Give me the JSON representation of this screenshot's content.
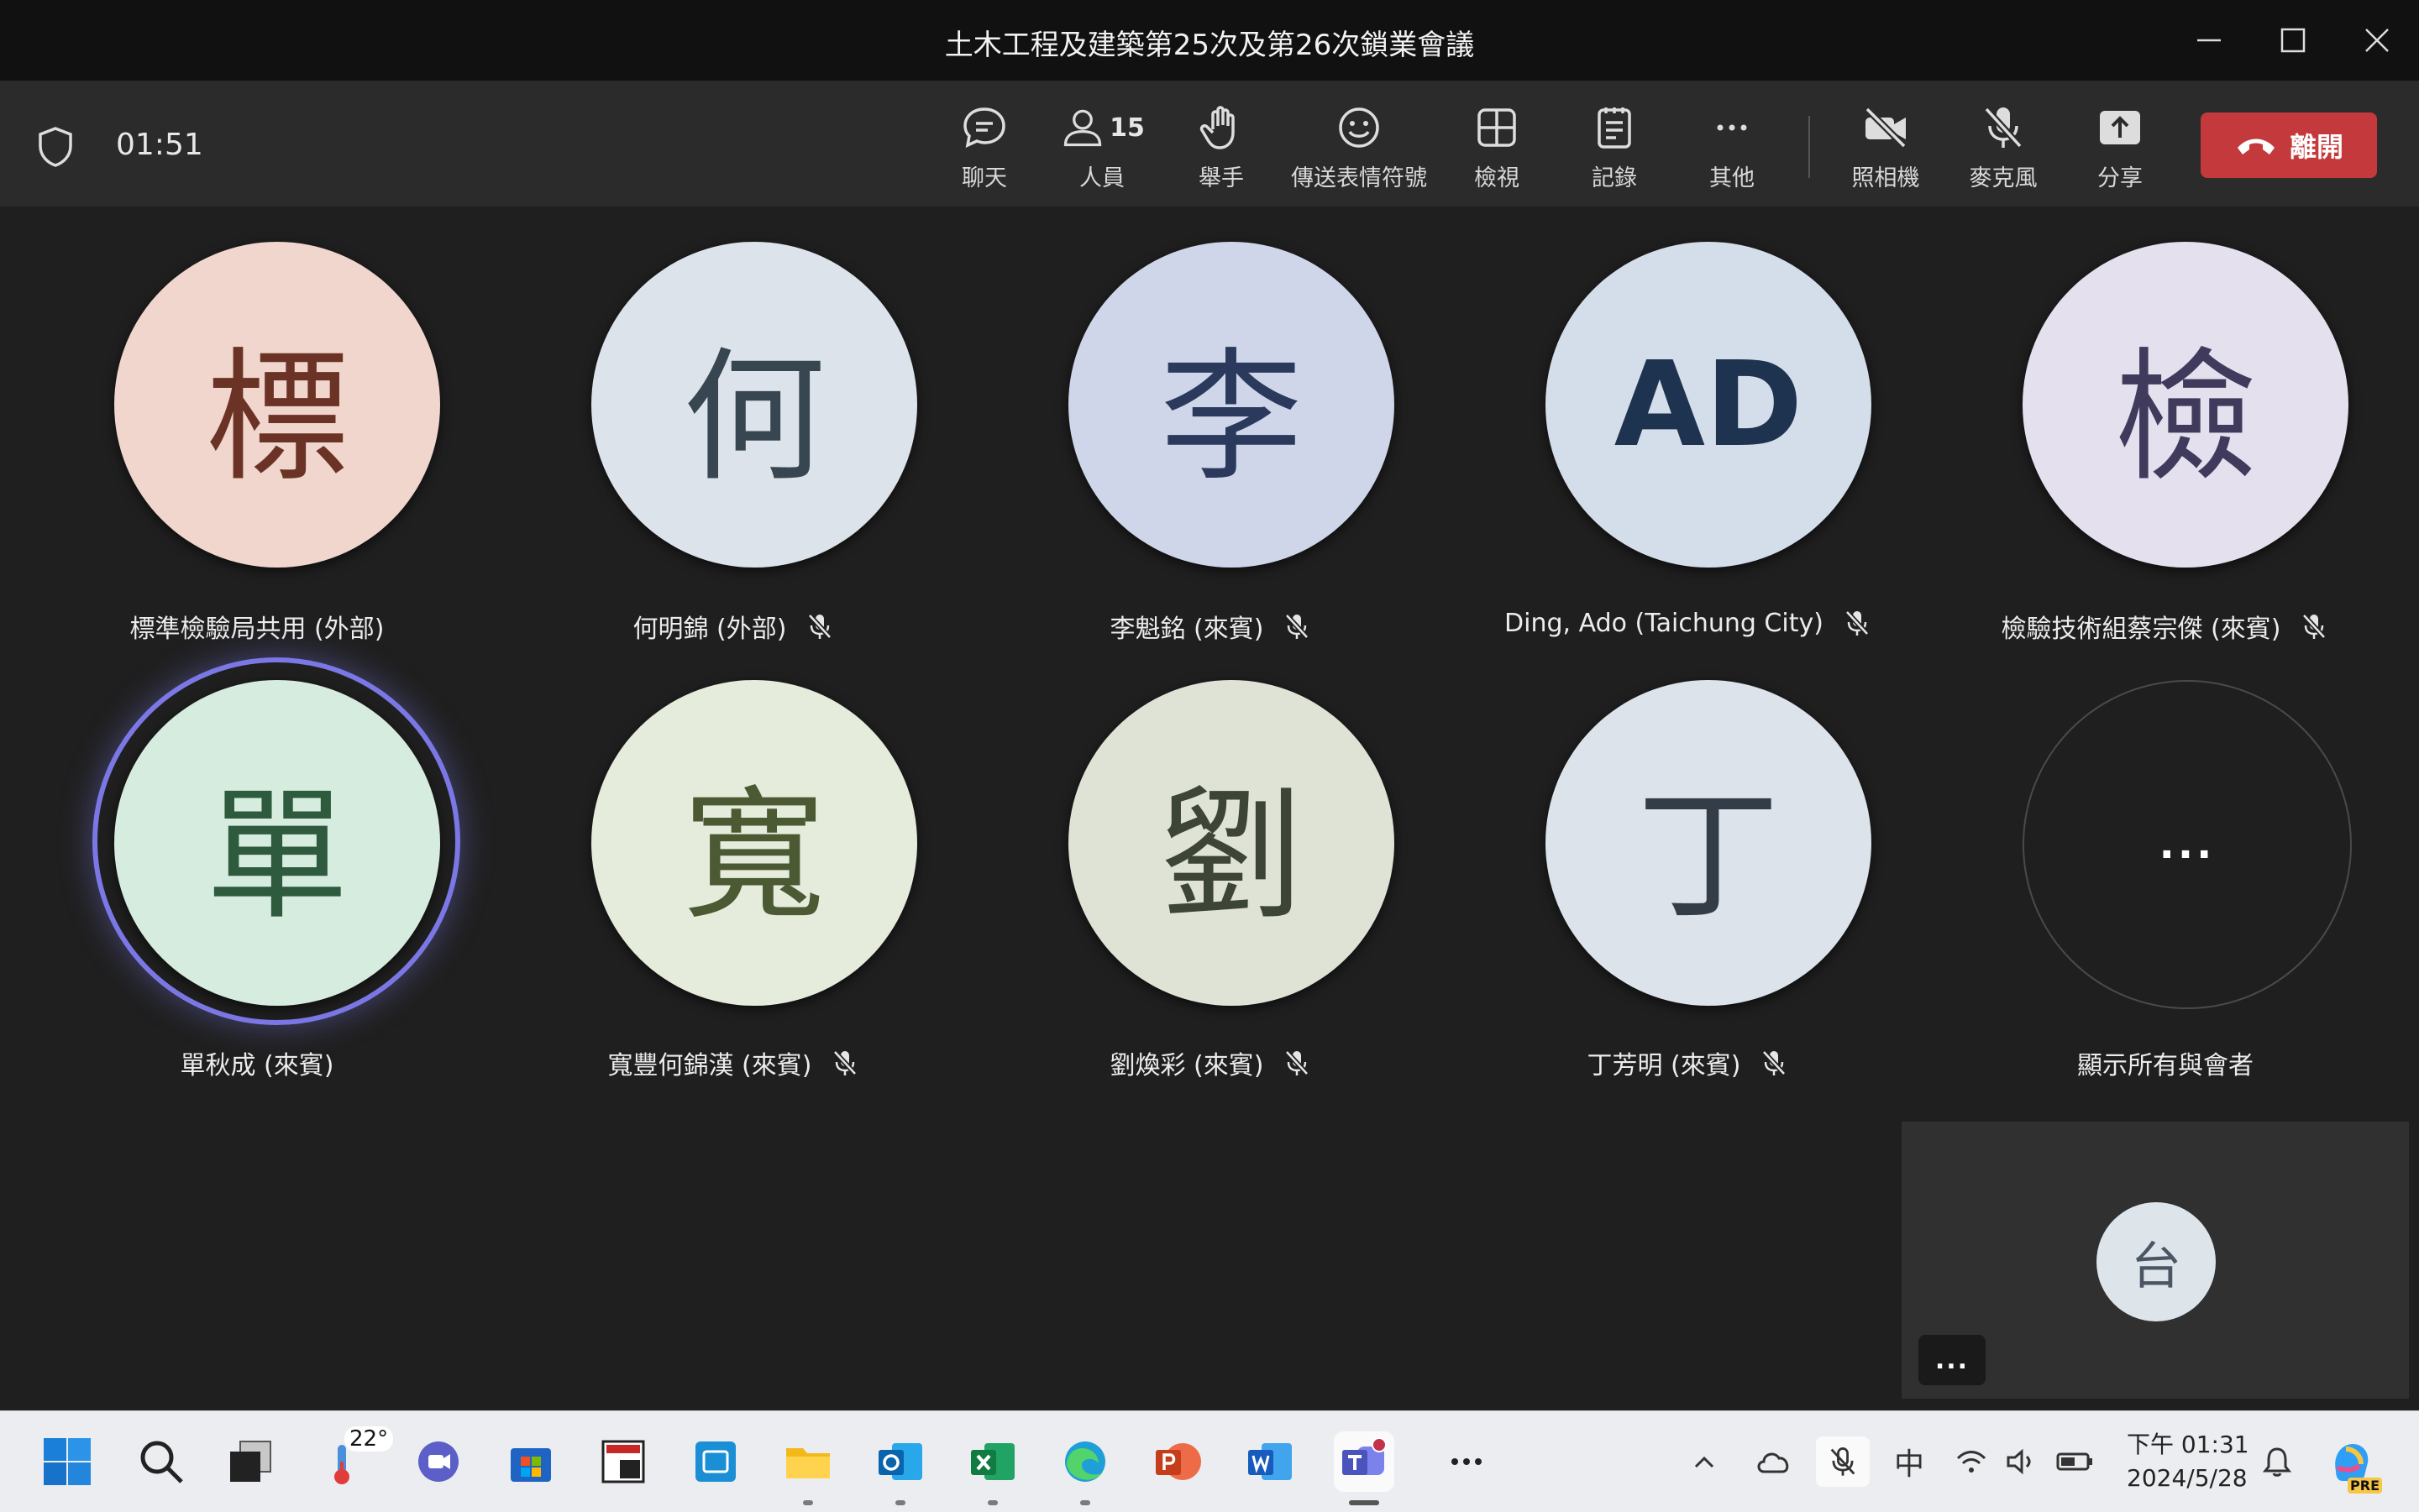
{
  "window": {
    "title": "土木工程及建築第25次及第26次鎖業會議"
  },
  "toolbar": {
    "timer": "01:51",
    "buttons": {
      "chat": "聊天",
      "people": "人員",
      "people_count": "15",
      "raise": "舉手",
      "react": "傳送表情符號",
      "view": "檢視",
      "notes": "記錄",
      "more": "其他",
      "camera": "照相機",
      "mic": "麥克風",
      "share": "分享"
    },
    "leave": "離開"
  },
  "participants": [
    {
      "initial": "標",
      "name": "標準檢驗局共用 (外部)",
      "bg": "#f0d6cc",
      "fg": "#6b3226",
      "muted": false
    },
    {
      "initial": "何",
      "name": "何明錦 (外部)",
      "bg": "#dce3ea",
      "fg": "#374651",
      "muted": true
    },
    {
      "initial": "李",
      "name": "李魁銘 (來賓)",
      "bg": "#cfd6ea",
      "fg": "#2b3a5c",
      "muted": true
    },
    {
      "initial": "AD",
      "name": "Ding, Ado (Taichung City)",
      "bg": "#d4deea",
      "fg": "#1e3350",
      "muted": true
    },
    {
      "initial": "檢",
      "name": "檢驗技術組蔡宗傑 (來賓)",
      "bg": "#e4e0ee",
      "fg": "#403b5c",
      "muted": true
    },
    {
      "initial": "單",
      "name": "單秋成 (來賓)",
      "bg": "#d6ecdf",
      "fg": "#2e5a3e",
      "muted": false,
      "speaking": true
    },
    {
      "initial": "寬",
      "name": "寬豐何錦漢 (來賓)",
      "bg": "#e6ecdc",
      "fg": "#4c5a33",
      "muted": true
    },
    {
      "initial": "劉",
      "name": "劉煥彩 (來賓)",
      "bg": "#dfe3d6",
      "fg": "#3d4636",
      "muted": true
    },
    {
      "initial": "丁",
      "name": "丁芳明 (來賓)",
      "bg": "#dce3ea",
      "fg": "#333d47",
      "muted": true
    }
  ],
  "show_all": {
    "label": "顯示所有與會者",
    "glyph": "..."
  },
  "self_view": {
    "initial": "台",
    "more": "..."
  },
  "taskbar": {
    "weather": "22°",
    "ime": "中",
    "time": "下午 01:31",
    "date": "2024/5/28",
    "copilot_badge": "PRE"
  }
}
